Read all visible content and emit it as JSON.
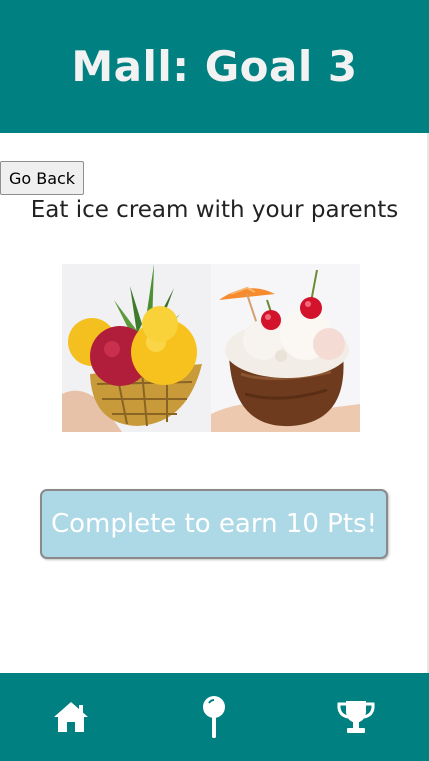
{
  "header": {
    "title": "Mall: Goal 3"
  },
  "back_button": {
    "label": "Go Back"
  },
  "goal": {
    "description": "Eat ice cream with your parents"
  },
  "photo": {
    "left_subject": "ice cream scoops in a pineapple",
    "right_subject": "ice cream in a coconut shell with cherries and umbrella"
  },
  "complete_button": {
    "label": "Complete to earn 10 Pts!"
  },
  "bottom_nav": {
    "items": [
      {
        "icon": "home-icon"
      },
      {
        "icon": "map-pin-icon"
      },
      {
        "icon": "trophy-icon"
      }
    ]
  },
  "colors": {
    "header_bg": "#008080",
    "footer_bg": "#008080",
    "button_bg": "#add8e6",
    "title_text": "#f2f2f2"
  }
}
